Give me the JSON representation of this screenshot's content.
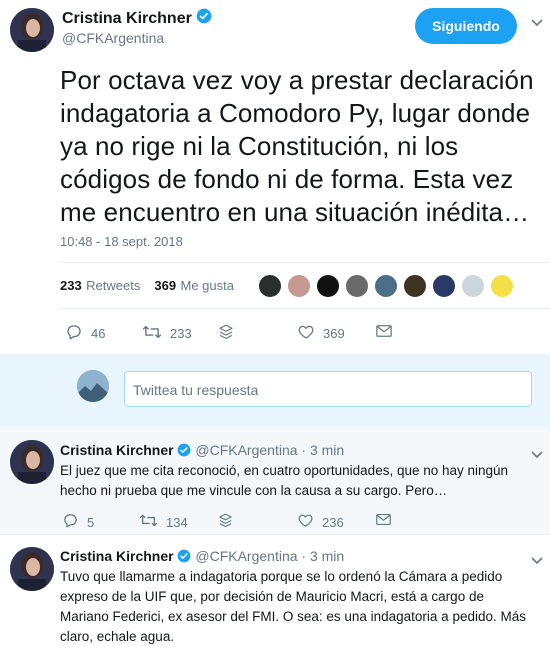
{
  "main_tweet": {
    "author_name": "Cristina Kirchner",
    "author_handle": "@CFKArgentina",
    "follow_label": "Siguiendo",
    "text": "Por octava vez voy a prestar declaración indagatoria a Comodoro Py, lugar donde ya no rige ni la Constitución, ni los códigos de fondo ni de forma. Esta vez me encuentro en una situación inédita…",
    "timestamp": "10:48 - 18 sept. 2018",
    "retweets_count": "233",
    "retweets_label": "Retweets",
    "likes_count": "369",
    "likes_label": "Me gusta",
    "actions": {
      "reply": "46",
      "retweet": "233",
      "like": "369"
    }
  },
  "reply_composer": {
    "placeholder": "Twittea tu respuesta"
  },
  "thread": [
    {
      "author_name": "Cristina Kirchner",
      "author_handle": "@CFKArgentina",
      "time": "· 3 min",
      "text": "El juez que me cita reconoció, en cuatro oportunidades, que no hay ningún hecho ni prueba que me vincule con la causa a su cargo. Pero…",
      "actions": {
        "reply": "5",
        "retweet": "134",
        "like": "236"
      }
    },
    {
      "author_name": "Cristina Kirchner",
      "author_handle": "@CFKArgentina",
      "time": "· 3 min",
      "text": "Tuvo que llamarme a indagatoria porque se lo ordenó la Cámara a pedido expreso de la UIF que, por decisión de Mauricio Macri, está a cargo de Mariano Federici, ex asesor del FMI. O sea: es una indagatoria a pedido. Más claro, echale agua."
    }
  ],
  "colors": {
    "accent": "#1da1f2",
    "secondary_text": "#657786",
    "divider": "#e6ecf0",
    "thread_bg": "#f5f8fa"
  }
}
